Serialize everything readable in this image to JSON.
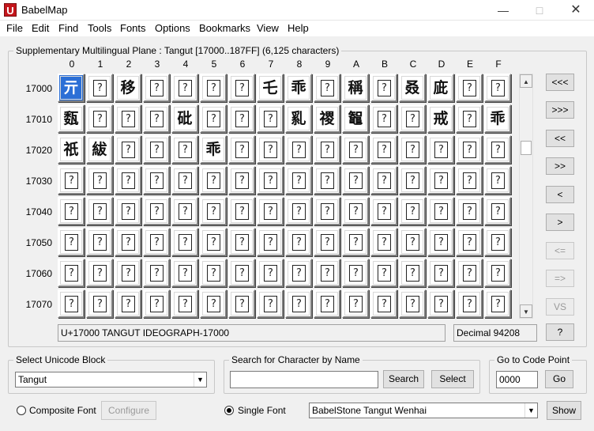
{
  "window": {
    "title": "BabelMap",
    "app_icon_letter": "U"
  },
  "menu": [
    "File",
    "Edit",
    "Find",
    "Tools",
    "Fonts",
    "Options",
    "Bookmarks",
    "View",
    "Help"
  ],
  "grid_group_title": "Supplementary Multilingual Plane : Tangut [17000..187FF] (6,125 characters)",
  "columns": [
    "0",
    "1",
    "2",
    "3",
    "4",
    "5",
    "6",
    "7",
    "8",
    "9",
    "A",
    "B",
    "C",
    "D",
    "E",
    "F"
  ],
  "rows": [
    {
      "label": "17000",
      "cells": [
        "亓",
        "?",
        "移",
        "?",
        "?",
        "?",
        "?",
        "乇",
        "乖",
        "?",
        "稱",
        "?",
        "叒",
        "庛",
        "?",
        "?"
      ]
    },
    {
      "label": "17010",
      "cells": [
        "瓾",
        "?",
        "?",
        "?",
        "砒",
        "?",
        "?",
        "?",
        "乿",
        "禝",
        "鼅",
        "?",
        "?",
        "戒",
        "?",
        "乖"
      ]
    },
    {
      "label": "17020",
      "cells": [
        "祇",
        "紱",
        "?",
        "?",
        "?",
        "乖",
        "?",
        "?",
        "?",
        "?",
        "?",
        "?",
        "?",
        "?",
        "?",
        "?"
      ]
    },
    {
      "label": "17030",
      "cells": [
        "?",
        "?",
        "?",
        "?",
        "?",
        "?",
        "?",
        "?",
        "?",
        "?",
        "?",
        "?",
        "?",
        "?",
        "?",
        "?"
      ]
    },
    {
      "label": "17040",
      "cells": [
        "?",
        "?",
        "?",
        "?",
        "?",
        "?",
        "?",
        "?",
        "?",
        "?",
        "?",
        "?",
        "?",
        "?",
        "?",
        "?"
      ]
    },
    {
      "label": "17050",
      "cells": [
        "?",
        "?",
        "?",
        "?",
        "?",
        "?",
        "?",
        "?",
        "?",
        "?",
        "?",
        "?",
        "?",
        "?",
        "?",
        "?"
      ]
    },
    {
      "label": "17060",
      "cells": [
        "?",
        "?",
        "?",
        "?",
        "?",
        "?",
        "?",
        "?",
        "?",
        "?",
        "?",
        "?",
        "?",
        "?",
        "?",
        "?"
      ]
    },
    {
      "label": "17070",
      "cells": [
        "?",
        "?",
        "?",
        "?",
        "?",
        "?",
        "?",
        "?",
        "?",
        "?",
        "?",
        "?",
        "?",
        "?",
        "?",
        "?"
      ]
    }
  ],
  "nav_buttons": [
    "<<<",
    ">>>",
    "<<",
    ">>",
    "<",
    ">",
    "<=",
    "=>",
    "VS"
  ],
  "status": {
    "char_name": "U+17000 TANGUT IDEOGRAPH-17000",
    "decimal": "Decimal 94208",
    "help_button": "?"
  },
  "unicode_block": {
    "title": "Select Unicode Block",
    "value": "Tangut"
  },
  "search": {
    "title": "Search for Character by Name",
    "value": "",
    "search_button": "Search",
    "select_button": "Select"
  },
  "goto": {
    "title": "Go to Code Point",
    "value": "0000",
    "go_button": "Go"
  },
  "font": {
    "composite_label": "Composite Font",
    "configure_button": "Configure",
    "single_label": "Single Font",
    "single_checked": true,
    "font_name": "BabelStone Tangut Wenhai",
    "show_button": "Show"
  }
}
